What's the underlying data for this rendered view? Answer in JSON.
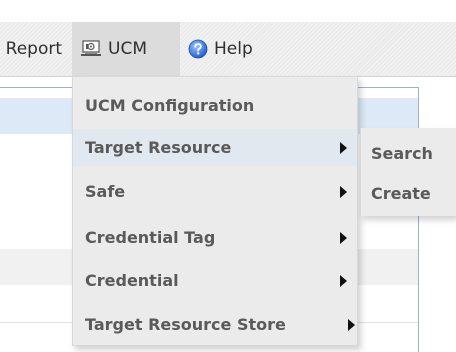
{
  "menubar": {
    "report_label": "Report",
    "ucm_label": "UCM",
    "help_label": "Help",
    "ucm_icon": "ucm-icon",
    "help_icon": "help-icon"
  },
  "ucm_menu": {
    "items": [
      {
        "label": "UCM Configuration",
        "has_submenu": false
      },
      {
        "label": "Target Resource",
        "has_submenu": true,
        "active": true
      },
      {
        "label": "Safe",
        "has_submenu": true
      },
      {
        "label": "Credential Tag",
        "has_submenu": true
      },
      {
        "label": "Credential",
        "has_submenu": true
      },
      {
        "label": "Target Resource Store",
        "has_submenu": true
      }
    ]
  },
  "target_resource_submenu": {
    "items": [
      {
        "label": "Search"
      },
      {
        "label": "Create"
      }
    ]
  },
  "colors": {
    "menu_background": "#ebebeb",
    "active_item": "#e2e8ef",
    "text": "#5a5a5a",
    "panel_band": "#dde9f7"
  }
}
